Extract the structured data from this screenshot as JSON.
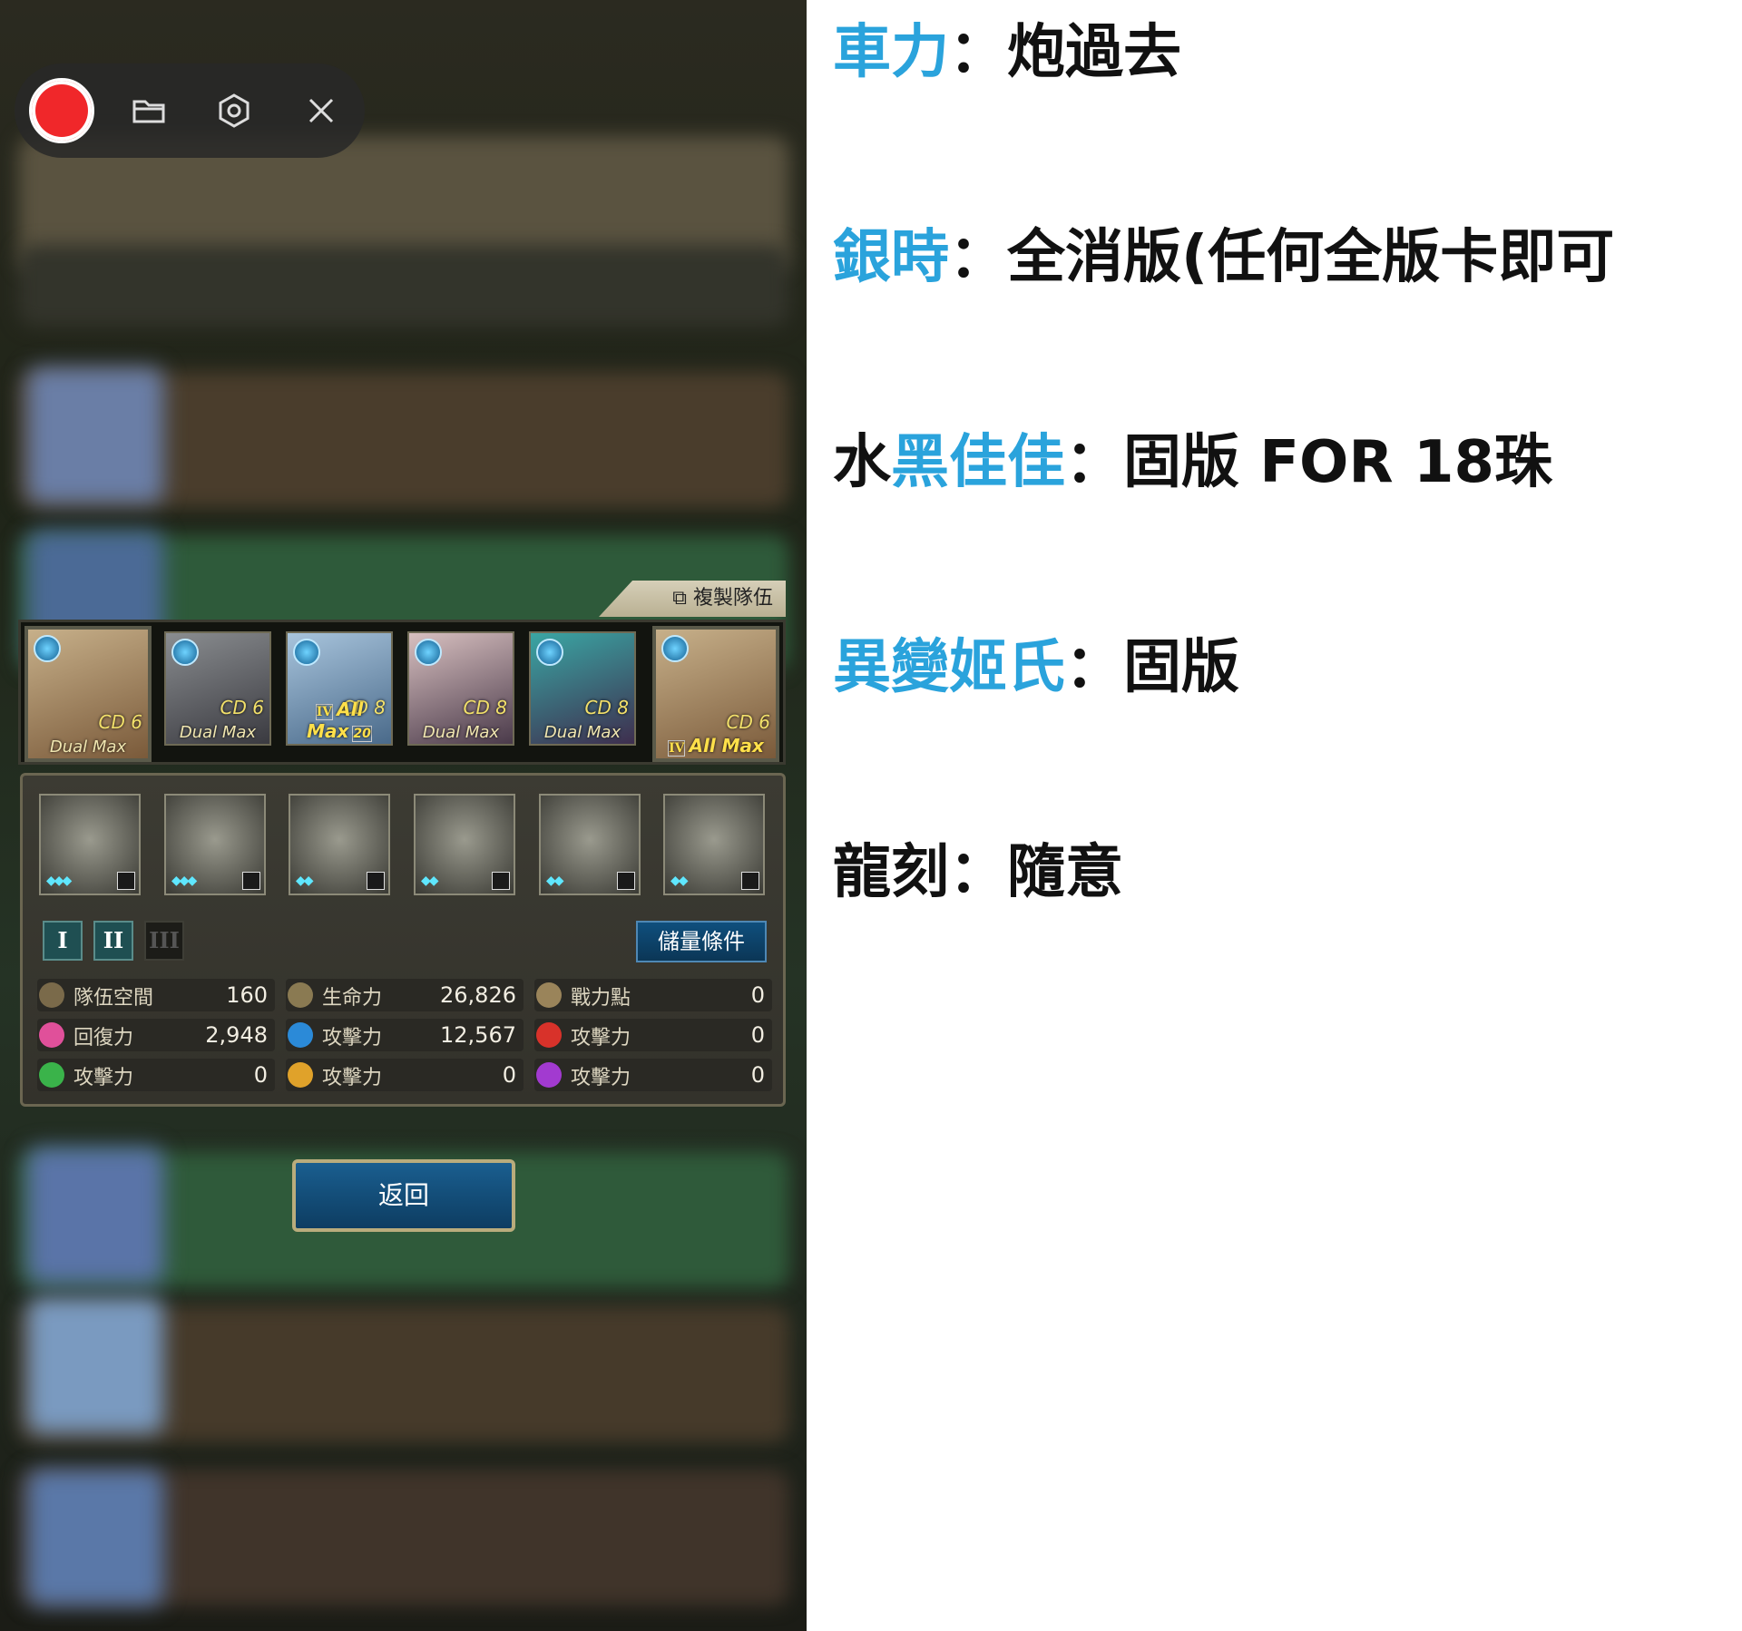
{
  "recorder": {
    "icons": [
      "record-icon",
      "folder-icon",
      "settings-icon",
      "close-icon"
    ]
  },
  "team": {
    "copy_label": "複製隊伍",
    "cards": [
      {
        "cd": "CD 6",
        "tag": "Dual Max"
      },
      {
        "cd": "CD 6",
        "tag": "Dual Max"
      },
      {
        "cd": "CD 8",
        "tag": "All Max",
        "rank": "IV",
        "level": "20"
      },
      {
        "cd": "CD 8",
        "tag": "Dual Max"
      },
      {
        "cd": "CD 8",
        "tag": "Dual Max"
      },
      {
        "cd": "CD 6",
        "tag": "All Max",
        "rank": "IV"
      }
    ]
  },
  "panel": {
    "phases": [
      "I",
      "II",
      "III"
    ],
    "store_label": "儲量條件",
    "stats": [
      {
        "label": "隊伍空間",
        "value": "160"
      },
      {
        "label": "生命力",
        "value": "26,826"
      },
      {
        "label": "戰力點",
        "value": "0"
      },
      {
        "label": "回復力",
        "value": "2,948"
      },
      {
        "label": "攻擊力",
        "value": "12,567"
      },
      {
        "label": "攻擊力",
        "value": "0"
      },
      {
        "label": "攻擊力",
        "value": "0"
      },
      {
        "label": "攻擊力",
        "value": "0"
      },
      {
        "label": "攻擊力",
        "value": "0"
      }
    ],
    "back_label": "返回"
  },
  "notes": [
    {
      "highlight": "車力",
      "prefix": "",
      "text": "：炮過去"
    },
    {
      "highlight": "銀時",
      "prefix": "",
      "text": "：全消版(任何全版卡即可"
    },
    {
      "highlight": "黑佳佳",
      "prefix": "水",
      "text": "：固版 FOR 18珠"
    },
    {
      "highlight": "異變姬氏",
      "prefix": "",
      "text": "：固版"
    },
    {
      "highlight": "",
      "prefix": "龍刻",
      "text": "：隨意"
    }
  ],
  "colors": {
    "highlight": "#2aa3dc",
    "record": "#f0272a"
  }
}
